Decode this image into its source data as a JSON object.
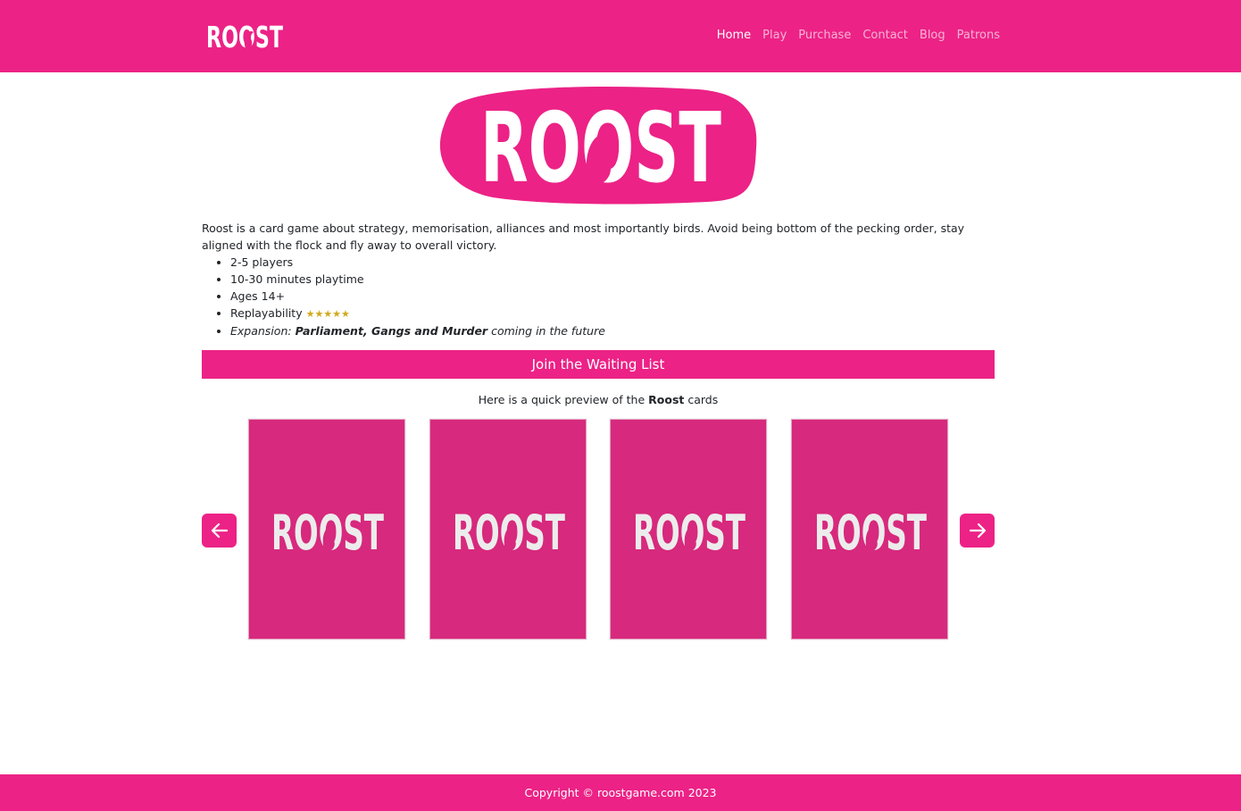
{
  "nav": {
    "brand": "ROOST",
    "links": [
      "Home",
      "Play",
      "Purchase",
      "Contact",
      "Blog",
      "Patrons"
    ]
  },
  "hero": {
    "logo_text": "ROOST"
  },
  "intro": {
    "description": "Roost is a card game about strategy, memorisation, alliances and most importantly birds. Avoid being bottom of the pecking order, stay aligned with the flock and fly away to overall victory.",
    "features": [
      "2-5 players",
      "10-30 minutes playtime",
      "Ages 14+"
    ],
    "replayability_label": "Replayability",
    "replayability_stars": "★★★★★",
    "expansion_prefix": "Expansion:",
    "expansion_name": "Parliament, Gangs and Murder",
    "expansion_suffix": "coming in the future"
  },
  "waitlist_button": "Join the Waiting List",
  "preview": {
    "prefix": "Here is a quick preview of the",
    "bold": "Roost",
    "suffix": "cards"
  },
  "carousel": {
    "cards": [
      "ROOST",
      "ROOST",
      "ROOST",
      "ROOST"
    ],
    "prev_icon": "arrow-left-icon",
    "next_icon": "arrow-right-icon"
  },
  "footer": {
    "copyright": "Copyright © roostgame.com 2023"
  },
  "colors": {
    "brand": "#ec2286",
    "card": "#d7297d",
    "stars": "#d1a91c"
  }
}
